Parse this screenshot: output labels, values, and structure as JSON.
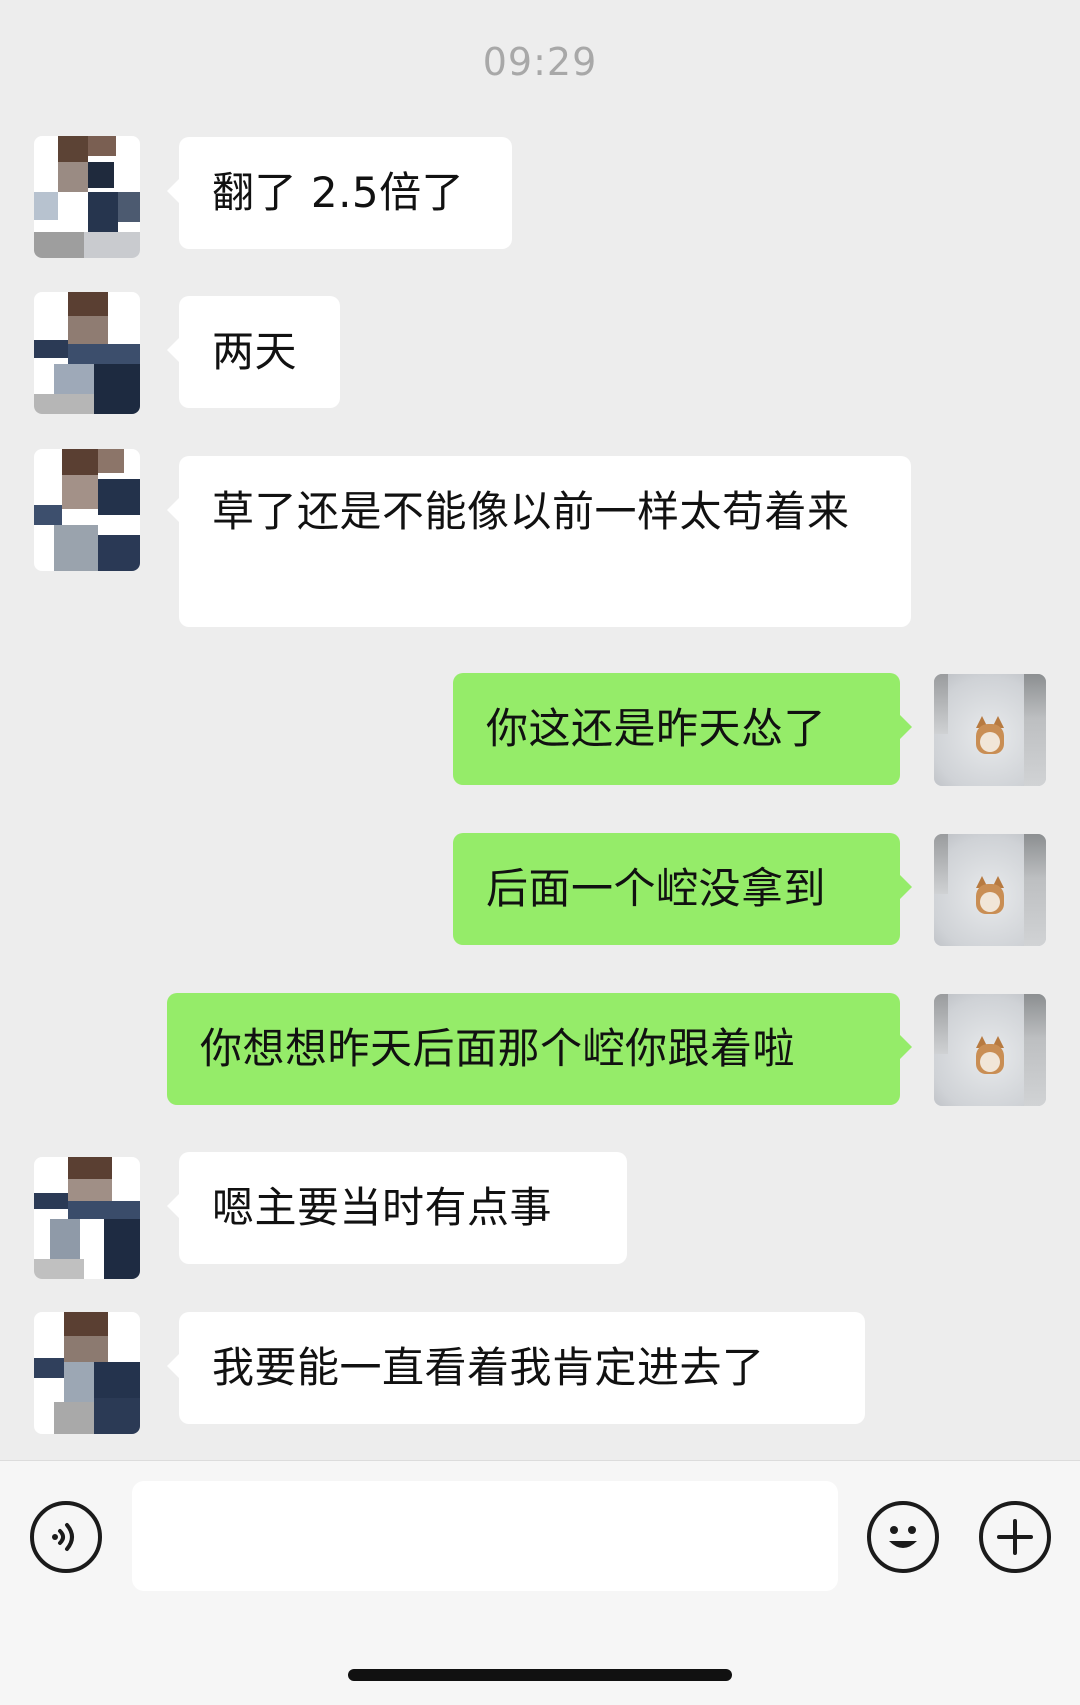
{
  "chat": {
    "timestamp": "09:29",
    "messages": [
      {
        "sender": "other",
        "text": "翻了 2.5倍了"
      },
      {
        "sender": "other",
        "text": "两天"
      },
      {
        "sender": "other",
        "text": "草了还是不能像以前一样太苟着来"
      },
      {
        "sender": "me",
        "text": "你这还是昨天怂了"
      },
      {
        "sender": "me",
        "text": "后面一个崆没拿到"
      },
      {
        "sender": "me",
        "text": "你想想昨天后面那个崆你跟着啦"
      },
      {
        "sender": "other",
        "text": "嗯主要当时有点事"
      },
      {
        "sender": "other",
        "text": "我要能一直看着我肯定进去了"
      }
    ]
  },
  "input_bar": {
    "voice_icon": "voice-icon",
    "emoji_icon": "emoji-icon",
    "plus_icon": "plus-icon",
    "text_value": ""
  },
  "colors": {
    "background": "#ededed",
    "incoming_bubble": "#ffffff",
    "outgoing_bubble": "#95ec69",
    "timestamp": "#a8a8a8"
  }
}
